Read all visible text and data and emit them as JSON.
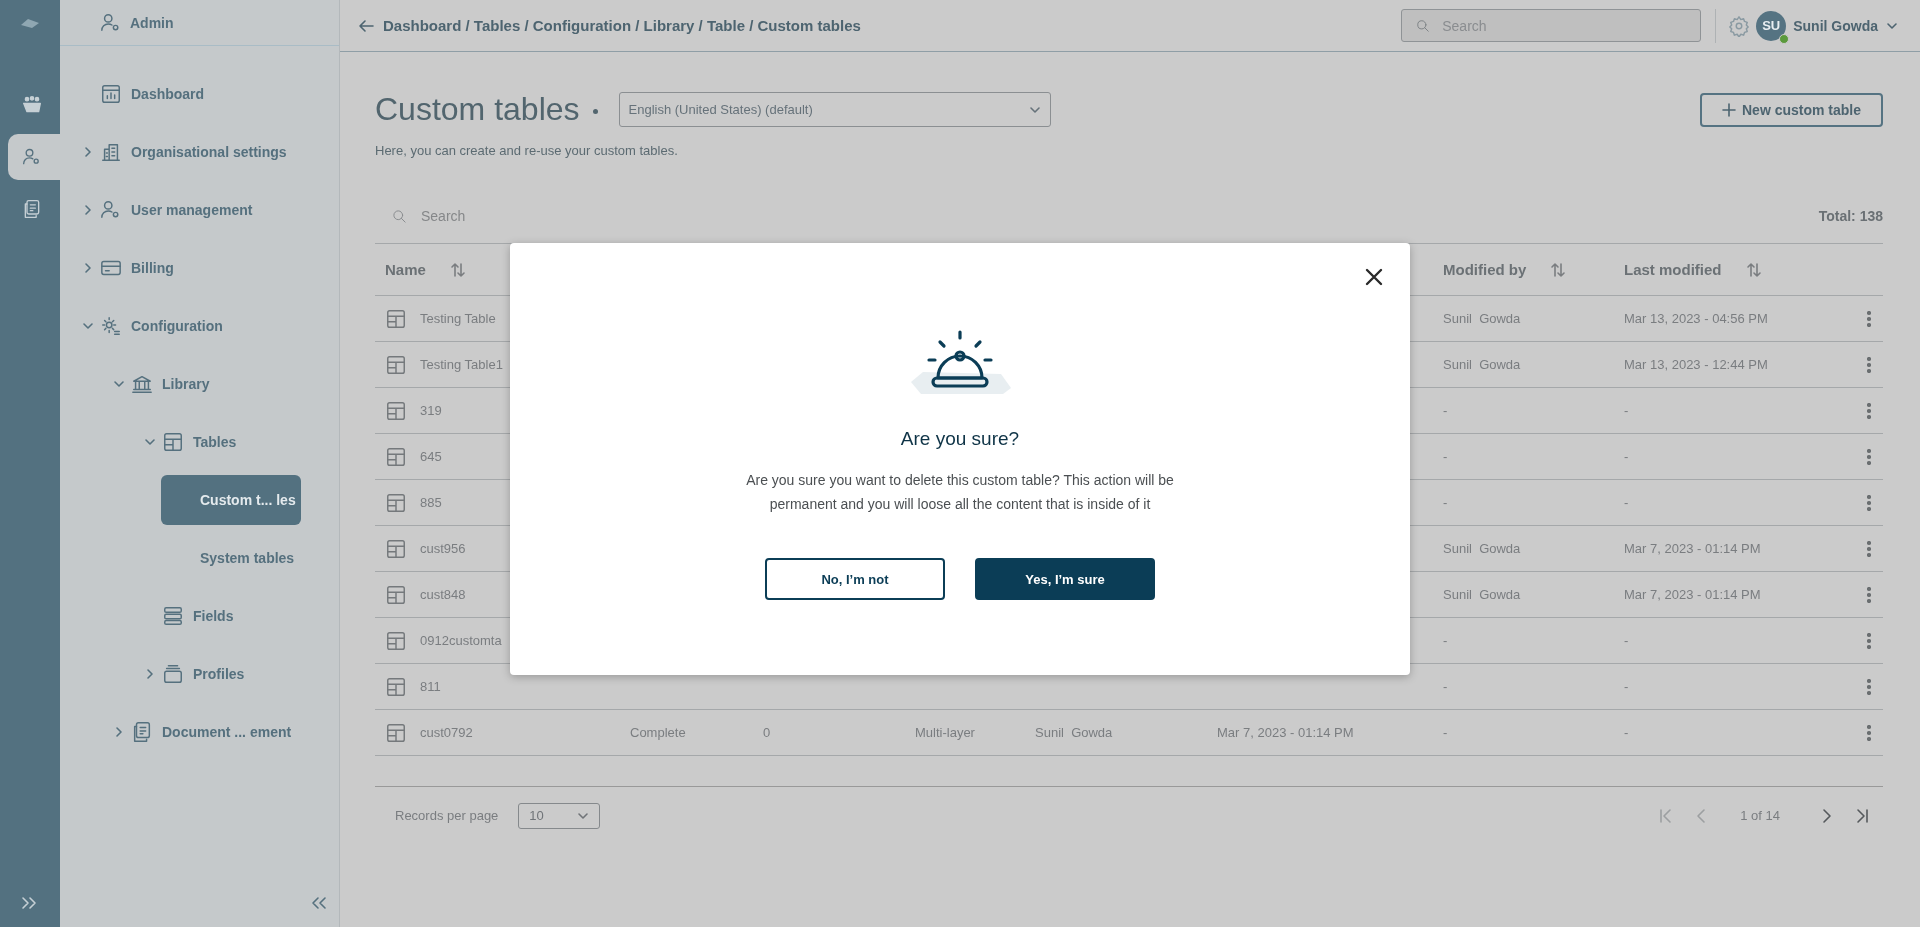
{
  "rail": {
    "items": [
      {
        "selected": false
      },
      {
        "selected": true
      },
      {
        "selected": false
      }
    ]
  },
  "sidebar": {
    "header": "Admin",
    "tree": [
      {
        "label": "Dashboard",
        "selected": false
      },
      {
        "label": "Organisational settings",
        "selected": false,
        "expanded": false
      },
      {
        "label": "User management",
        "selected": false,
        "expanded": false
      },
      {
        "label": "Billing",
        "selected": false,
        "expanded": false
      },
      {
        "label": "Configuration",
        "selected": false,
        "expanded": true,
        "children": [
          {
            "label": "Library",
            "selected": false,
            "expanded": true,
            "children": [
              {
                "label": "Tables",
                "selected": false,
                "expanded": true,
                "children": [
                  {
                    "label": "Custom t... les",
                    "selected": true
                  },
                  {
                    "label": "System tables",
                    "selected": false
                  }
                ]
              },
              {
                "label": "Fields",
                "selected": false
              },
              {
                "label": "Profiles",
                "selected": false,
                "expanded": false
              }
            ]
          },
          {
            "label": "Document ...  ement",
            "selected": false,
            "expanded": false
          }
        ]
      }
    ]
  },
  "topbar": {
    "breadcrumb": "Dashboard / Tables / Configuration / Library / Table / Custom tables",
    "search": {
      "placeholder": "Search"
    },
    "user": {
      "initials": "SU",
      "name": "Sunil Gowda",
      "online": true
    }
  },
  "page": {
    "title": "Custom tables",
    "language": "English (United States) (default)",
    "new_button": "New custom table",
    "description": "Here, you can create and re-use your custom tables.",
    "search": {
      "placeholder": "Search"
    },
    "total": "Total: 138"
  },
  "table": {
    "columns": [
      {
        "label": "Name",
        "sortable": true
      },
      {
        "label": "Modified by",
        "sortable": true
      },
      {
        "label": "Last modified",
        "sortable": true
      }
    ],
    "rows": [
      {
        "name": "Testing Table",
        "modified_by": "Sunil  Gowda",
        "last_modified": "Mar 13, 2023 - 04:56 PM"
      },
      {
        "name": "Testing Table1",
        "modified_by": "Sunil  Gowda",
        "last_modified": "Mar 13, 2023 - 12:44 PM"
      },
      {
        "name": "319",
        "modified_by": "-",
        "last_modified": "-"
      },
      {
        "name": "645",
        "modified_by": "-",
        "last_modified": "-"
      },
      {
        "name": "885",
        "modified_by": "-",
        "last_modified": "-"
      },
      {
        "name": "cust956",
        "modified_by": "Sunil  Gowda",
        "last_modified": "Mar 7, 2023 - 01:14 PM"
      },
      {
        "name": "cust848",
        "modified_by": "Sunil  Gowda",
        "last_modified": "Mar 7, 2023 - 01:14 PM"
      },
      {
        "name": "0912customta",
        "modified_by": "-",
        "last_modified": "-"
      },
      {
        "name": "811",
        "modified_by": "-",
        "last_modified": "-"
      },
      {
        "name": "cust0792",
        "column_2": "Complete",
        "column_3": "0",
        "column_4": "Multi-layer",
        "column_5": "Sunil  Gowda",
        "column_6": "Mar 7, 2023 - 01:14 PM",
        "modified_by": "-",
        "last_modified": "-"
      }
    ]
  },
  "pagination": {
    "label": "Records per page",
    "page_size": "10",
    "page_info": "1 of 14",
    "buttons": [
      {
        "disabled": true
      },
      {
        "disabled": true
      },
      {
        "disabled": false
      },
      {
        "disabled": false
      }
    ]
  },
  "modal": {
    "title": "Are you sure?",
    "message": "Are you sure you want to delete this custom table? This action will be permanent and you will loose all the content that is inside of it",
    "buttons": [
      {
        "label": "No, I’m not",
        "kind": "secondary"
      },
      {
        "label": "Yes, I’m sure",
        "kind": "primary"
      }
    ]
  }
}
